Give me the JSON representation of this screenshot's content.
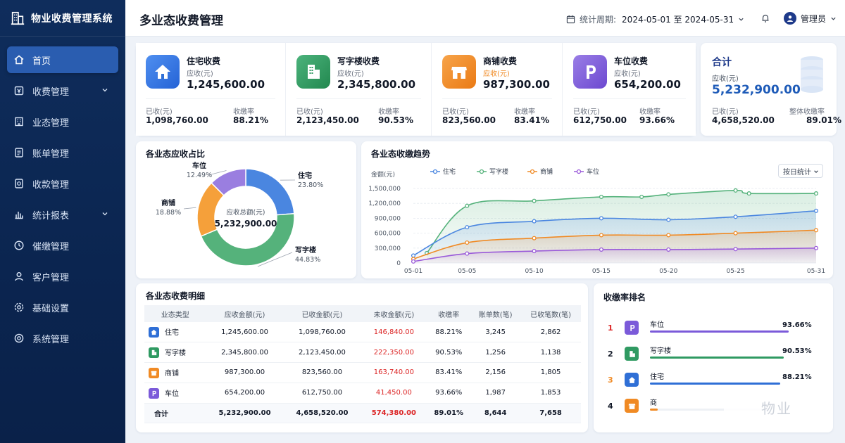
{
  "app": {
    "name": "物业收费管理系统"
  },
  "sidebar": {
    "items": [
      {
        "label": "首页",
        "icon": "home-icon",
        "active": true
      },
      {
        "label": "收费管理",
        "icon": "fee-icon",
        "expandable": true
      },
      {
        "label": "业态管理",
        "icon": "building-icon"
      },
      {
        "label": "账单管理",
        "icon": "bill-icon"
      },
      {
        "label": "收款管理",
        "icon": "wallet-icon"
      },
      {
        "label": "统计报表",
        "icon": "chart-icon",
        "expandable": true
      },
      {
        "label": "催缴管理",
        "icon": "clock-icon"
      },
      {
        "label": "客户管理",
        "icon": "user-icon"
      },
      {
        "label": "基础设置",
        "icon": "gear-icon"
      },
      {
        "label": "系统管理",
        "icon": "settings-icon"
      }
    ]
  },
  "header": {
    "title": "多业态收费管理",
    "period_label": "统计周期:",
    "period_value": "2024-05-01 至 2024-05-31",
    "user": "管理员"
  },
  "stats": [
    {
      "name": "住宅收费",
      "receivable_label": "应收(元)",
      "receivable": "1,245,600.00",
      "received_label": "已收(元)",
      "received": "1,098,760.00",
      "rate_label": "收缴率",
      "rate": "88.21%",
      "color": "#2f6fd6"
    },
    {
      "name": "写字楼收费",
      "receivable_label": "应收(元)",
      "receivable": "2,345,800.00",
      "received_label": "已收(元)",
      "received": "2,123,450.00",
      "rate_label": "收缴率",
      "rate": "90.53%",
      "color": "#2f9a62"
    },
    {
      "name": "商铺收费",
      "receivable_label": "应收(元)",
      "receivable": "987,300.00",
      "received_label": "已收(元)",
      "received": "823,560.00",
      "rate_label": "收缴率",
      "rate": "83.41%",
      "color": "#f08a24"
    },
    {
      "name": "车位收费",
      "receivable_label": "应收(元)",
      "receivable": "654,200.00",
      "received_label": "已收(元)",
      "received": "612,750.00",
      "rate_label": "收缴率",
      "rate": "93.66%",
      "color": "#7b5ad9"
    }
  ],
  "total": {
    "title": "合计",
    "receivable_label": "应收(元)",
    "receivable": "5,232,900.00",
    "received_label": "已收(元)",
    "received": "4,658,520.00",
    "rate_label": "整体收缴率",
    "rate": "89.01%"
  },
  "donut": {
    "title": "各业态应收占比",
    "center_label": "应收总额(元)",
    "center_value": "5,232,900.00"
  },
  "trend": {
    "title": "各业态收缴趋势",
    "select": "按日统计"
  },
  "table": {
    "title": "各业态收费明细",
    "headers": [
      "业态类型",
      "应收金额(元)",
      "已收金额(元)",
      "未收金额(元)",
      "收缴率",
      "账单数(笔)",
      "已收笔数(笔)"
    ],
    "rows": [
      {
        "type": "住宅",
        "icon": "house-icon",
        "color": "#2f6fd6",
        "cells": [
          "1,245,600.00",
          "1,098,760.00",
          "146,840.00",
          "88.21%",
          "3,245",
          "2,862"
        ]
      },
      {
        "type": "写字楼",
        "icon": "office-icon",
        "color": "#2f9a62",
        "cells": [
          "2,345,800.00",
          "2,123,450.00",
          "222,350.00",
          "90.53%",
          "1,256",
          "1,138"
        ]
      },
      {
        "type": "商铺",
        "icon": "shop-icon",
        "color": "#f08a24",
        "cells": [
          "987,300.00",
          "823,560.00",
          "163,740.00",
          "83.41%",
          "2,156",
          "1,805"
        ]
      },
      {
        "type": "车位",
        "icon": "parking-icon",
        "color": "#7b5ad9",
        "cells": [
          "654,200.00",
          "612,750.00",
          "41,450.00",
          "93.66%",
          "1,987",
          "1,853"
        ]
      }
    ],
    "sum": {
      "type": "合计",
      "cells": [
        "5,232,900.00",
        "4,658,520.00",
        "574,380.00",
        "89.01%",
        "8,644",
        "7,658"
      ]
    }
  },
  "ranking": {
    "title": "收缴率排名",
    "items": [
      {
        "rank": "1",
        "label": "车位",
        "rate": "93.66%",
        "fill": 0.9366,
        "color": "#7b5ad9",
        "rank_color": "#dc2626",
        "icon": "parking-icon"
      },
      {
        "rank": "2",
        "label": "写字楼",
        "rate": "90.53%",
        "fill": 0.9053,
        "color": "#2f9a62",
        "rank_color": "#111827",
        "icon": "office-icon"
      },
      {
        "rank": "3",
        "label": "住宅",
        "rate": "88.21%",
        "fill": 0.8821,
        "color": "#2f6fd6",
        "rank_color": "#f08a24",
        "icon": "house-icon"
      },
      {
        "rank": "4",
        "label": "商",
        "rate": "",
        "fill": 0.05,
        "color": "#f08a24",
        "rank_color": "#111827",
        "icon": "shop-icon"
      }
    ]
  },
  "watermark": "物业",
  "chart_data": [
    {
      "type": "pie",
      "title": "各业态应收占比",
      "categories": [
        "住宅",
        "写字楼",
        "商铺",
        "车位"
      ],
      "values": [
        23.8,
        44.83,
        18.88,
        12.49
      ],
      "value_labels": [
        "23.80%",
        "44.83%",
        "18.88%",
        "12.49%"
      ],
      "colors": [
        "#4a86e0",
        "#55b27b",
        "#f5a03a",
        "#9a7ee0"
      ]
    },
    {
      "type": "area",
      "title": "各业态收缴趋势",
      "ylabel": "金额(元)",
      "ylim": [
        0,
        1500000
      ],
      "yticks": [
        "0",
        "300,000",
        "600,000",
        "900,000",
        "1,200,000",
        "1,500,000"
      ],
      "yticks_values": [
        0,
        300000,
        600000,
        900000,
        1200000,
        1500000
      ],
      "x": [
        "05-01",
        "05-05",
        "05-10",
        "05-15",
        "05-20",
        "05-25",
        "05-31"
      ],
      "x_index": [
        1,
        5,
        10,
        15,
        20,
        25,
        31
      ],
      "legend_position": "top",
      "grid": true,
      "series": [
        {
          "name": "写字楼",
          "color": "#55b27b",
          "x": [
            2,
            5,
            10,
            15,
            18,
            20,
            25,
            26,
            31
          ],
          "values": [
            200000,
            1150000,
            1250000,
            1330000,
            1330000,
            1380000,
            1460000,
            1400000,
            1400000
          ]
        },
        {
          "name": "住宅",
          "color": "#4a86e0",
          "x": [
            1,
            5,
            10,
            15,
            20,
            25,
            31
          ],
          "values": [
            150000,
            720000,
            840000,
            900000,
            870000,
            930000,
            1050000
          ]
        },
        {
          "name": "商铺",
          "color": "#f08a24",
          "x": [
            1,
            5,
            10,
            15,
            20,
            25,
            31
          ],
          "values": [
            80000,
            410000,
            500000,
            560000,
            560000,
            600000,
            660000
          ]
        },
        {
          "name": "车位",
          "color": "#9a5ad9",
          "x": [
            1,
            5,
            10,
            15,
            20,
            25,
            31
          ],
          "values": [
            30000,
            190000,
            240000,
            270000,
            270000,
            280000,
            300000
          ]
        }
      ],
      "legend_order": [
        "住宅",
        "写字楼",
        "商铺",
        "车位"
      ]
    }
  ]
}
